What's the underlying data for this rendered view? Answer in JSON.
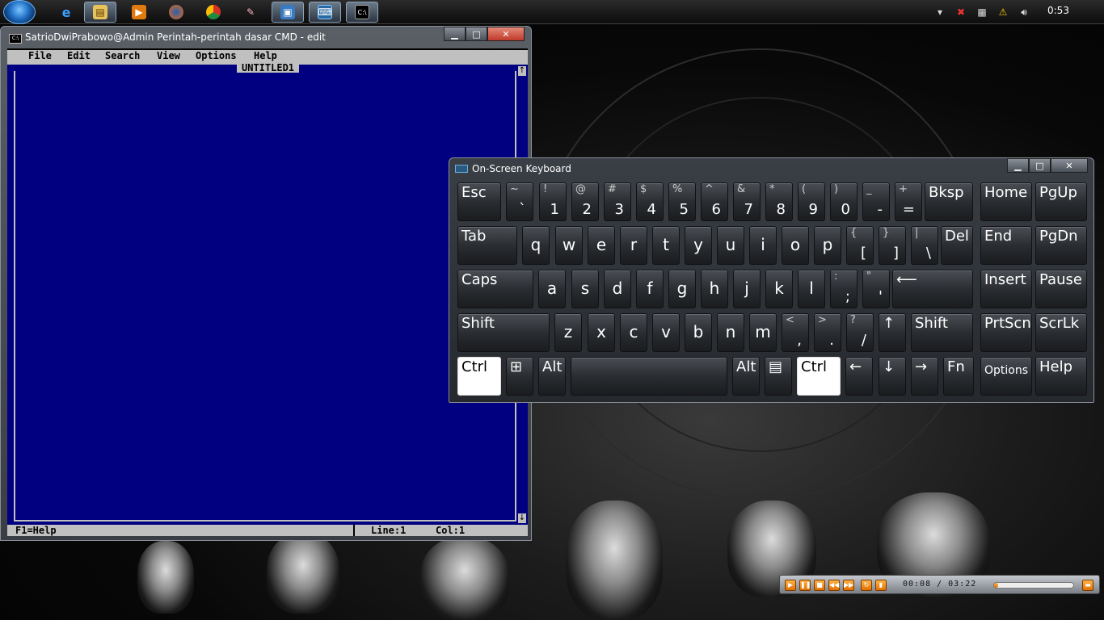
{
  "taskbar": {
    "clock": "0:53",
    "pinned": [
      {
        "name": "internet-explorer",
        "glyph": "e"
      },
      {
        "name": "windows-explorer",
        "glyph": "▤"
      },
      {
        "name": "media-player",
        "glyph": "▶"
      },
      {
        "name": "firefox",
        "glyph": "●"
      },
      {
        "name": "chrome",
        "glyph": "◉"
      },
      {
        "name": "paint",
        "glyph": "✎"
      },
      {
        "name": "remote-desktop",
        "glyph": "▣"
      },
      {
        "name": "on-screen-keyboard",
        "glyph": "⌨"
      },
      {
        "name": "command-prompt",
        "glyph": "C:\\"
      }
    ]
  },
  "cmd_window": {
    "title": "SatrioDwiPrabowo@Admin Perintah-perintah dasar CMD - edit",
    "icon_text": "C:\\",
    "controls": {
      "minimize": "▁",
      "maximize": "□",
      "close": "✕"
    },
    "menu": {
      "file": "File",
      "edit": "Edit",
      "search": "Search",
      "view": "View",
      "options": "Options",
      "help": "Help"
    },
    "document_title": "UNTITLED1",
    "scroll_up": "↑",
    "scroll_down": "↓",
    "status": {
      "help": "F1=Help",
      "line": "Line:1",
      "col": "Col:1"
    }
  },
  "osk": {
    "title": "On-Screen Keyboard",
    "controls": {
      "minimize": "▁",
      "maximize": "□",
      "close": "✕"
    },
    "row1": [
      {
        "label": "Esc"
      },
      {
        "top": "~",
        "bottom": "`"
      },
      {
        "top": "!",
        "bottom": "1"
      },
      {
        "top": "@",
        "bottom": "2"
      },
      {
        "top": "#",
        "bottom": "3"
      },
      {
        "top": "$",
        "bottom": "4"
      },
      {
        "top": "%",
        "bottom": "5"
      },
      {
        "top": "^",
        "bottom": "6"
      },
      {
        "top": "&",
        "bottom": "7"
      },
      {
        "top": "*",
        "bottom": "8"
      },
      {
        "top": "(",
        "bottom": "9"
      },
      {
        "top": ")",
        "bottom": "0"
      },
      {
        "top": "_",
        "bottom": "-"
      },
      {
        "top": "+",
        "bottom": "="
      },
      {
        "label": "Bksp"
      },
      {
        "label": "Home"
      },
      {
        "label": "PgUp"
      }
    ],
    "row2": [
      {
        "label": "Tab"
      },
      {
        "label": "q"
      },
      {
        "label": "w"
      },
      {
        "label": "e"
      },
      {
        "label": "r"
      },
      {
        "label": "t"
      },
      {
        "label": "y"
      },
      {
        "label": "u"
      },
      {
        "label": "i"
      },
      {
        "label": "o"
      },
      {
        "label": "p"
      },
      {
        "top": "{",
        "bottom": "["
      },
      {
        "top": "}",
        "bottom": "]"
      },
      {
        "top": "|",
        "bottom": "\\"
      },
      {
        "label": "Del"
      },
      {
        "label": "End"
      },
      {
        "label": "PgDn"
      }
    ],
    "row3": [
      {
        "label": "Caps"
      },
      {
        "label": "a"
      },
      {
        "label": "s"
      },
      {
        "label": "d"
      },
      {
        "label": "f"
      },
      {
        "label": "g"
      },
      {
        "label": "h"
      },
      {
        "label": "j"
      },
      {
        "label": "k"
      },
      {
        "label": "l"
      },
      {
        "top": ":",
        "bottom": ";"
      },
      {
        "top": "\"",
        "bottom": "'"
      },
      {
        "label": "⟵"
      },
      {
        "label": "Insert"
      },
      {
        "label": "Pause"
      }
    ],
    "row4": [
      {
        "label": "Shift"
      },
      {
        "label": "z"
      },
      {
        "label": "x"
      },
      {
        "label": "c"
      },
      {
        "label": "v"
      },
      {
        "label": "b"
      },
      {
        "label": "n"
      },
      {
        "label": "m"
      },
      {
        "top": "<",
        "bottom": ","
      },
      {
        "top": ">",
        "bottom": "."
      },
      {
        "top": "?",
        "bottom": "/"
      },
      {
        "label": "↑"
      },
      {
        "label": "Shift"
      },
      {
        "label": "PrtScn"
      },
      {
        "label": "ScrLk"
      }
    ],
    "row5": [
      {
        "label": "Ctrl"
      },
      {
        "label": "⊞"
      },
      {
        "label": "Alt"
      },
      {
        "label": ""
      },
      {
        "label": "Alt"
      },
      {
        "label": "▤"
      },
      {
        "label": "Ctrl"
      },
      {
        "label": "←"
      },
      {
        "label": "↓"
      },
      {
        "label": "→"
      },
      {
        "label": "Fn"
      },
      {
        "label": "Options"
      },
      {
        "label": "Help"
      }
    ]
  },
  "media_player": {
    "time": "00:08 / 03:22",
    "volume_fraction": 0.05
  }
}
